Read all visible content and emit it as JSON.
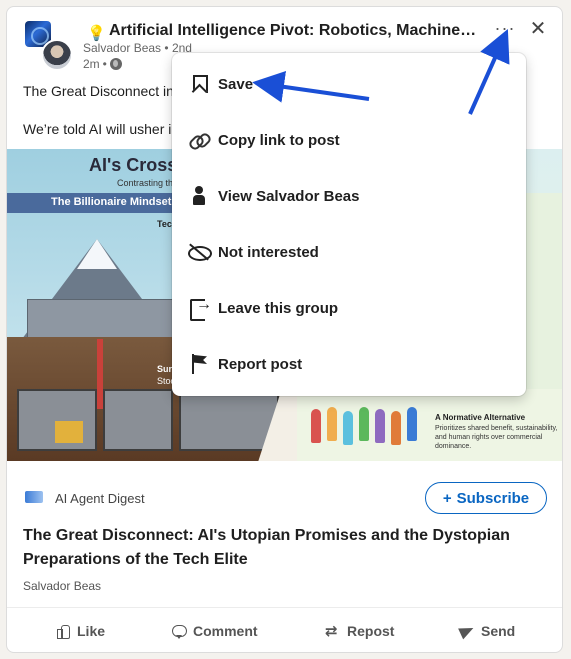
{
  "post": {
    "emoji": "💡",
    "title": "Artificial Intelligence Pivot: Robotics, Machine L...",
    "author": "Salvador Beas",
    "degree": "2nd",
    "time": "2m",
    "separator": "•",
    "more_label": "···",
    "close_label": "✕",
    "body_line_1": "The Great Disconnect in",
    "body_line_2": "We’re told AI will usher i"
  },
  "infographic": {
    "title": "AI's Cross",
    "subtitle": "Contrasting the \"e",
    "banner": "The Billionaire Mindset:",
    "tech_label": "Tech",
    "surv_label": "Surv",
    "stock_label": "Stoc",
    "normative_title": "A Normative Alternative",
    "normative_text": "Prioritizes shared benefit, sustainability, and human rights over commercial dominance."
  },
  "newsletter": {
    "name": "AI Agent Digest",
    "subscribe_label": "Subscribe",
    "subscribe_prefix": "+",
    "article_title": "The Great Disconnect: AI's Utopian Promises and the Dystopian Preparations of the Tech Elite",
    "article_author": "Salvador Beas"
  },
  "actions": {
    "like": "Like",
    "comment": "Comment",
    "repost": "Repost",
    "send": "Send"
  },
  "menu": {
    "items": [
      {
        "label": "Save",
        "icon": "bookmark-icon"
      },
      {
        "label": "Copy link to post",
        "icon": "link-icon"
      },
      {
        "label": "View Salvador Beas",
        "icon": "person-icon"
      },
      {
        "label": "Not interested",
        "icon": "eye-off-icon"
      },
      {
        "label": "Leave this group",
        "icon": "leave-icon"
      },
      {
        "label": "Report post",
        "icon": "flag-icon"
      }
    ]
  },
  "colors": {
    "accent": "#0a66c2",
    "annotation_arrow": "#1a4fd6"
  }
}
